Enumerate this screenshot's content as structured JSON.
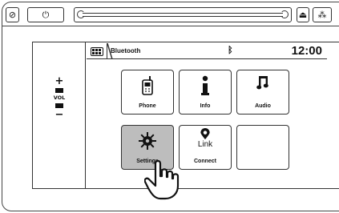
{
  "top_controls": {
    "left_buttons": [
      {
        "name": "power-button",
        "glyph": "⊘"
      },
      {
        "name": "knob-button",
        "glyph": "⏻"
      }
    ],
    "right_buttons": [
      {
        "name": "eject-button",
        "glyph": "⏏"
      },
      {
        "name": "seek-button",
        "glyph": "⁂"
      }
    ]
  },
  "volume": {
    "plus": "+",
    "label": "VOL",
    "minus": "−"
  },
  "status_bar": {
    "title": "Bluetooth",
    "bluetooth_symbol": "ᛒ",
    "time": "12:00"
  },
  "apps": [
    {
      "id": "phone",
      "label": "Phone",
      "icon": "phone-icon",
      "active": false
    },
    {
      "id": "info",
      "label": "Info",
      "icon": "info-icon",
      "active": false
    },
    {
      "id": "audio",
      "label": "Audio",
      "icon": "music-note-icon",
      "active": false
    },
    {
      "id": "settings",
      "label": "Settings",
      "icon": "gear-icon",
      "active": true
    },
    {
      "id": "connect",
      "label": "Connect",
      "icon": "link-icon",
      "active": false,
      "icon_text": "Link"
    },
    {
      "id": "empty",
      "label": "",
      "icon": "",
      "active": false
    }
  ],
  "colors": {
    "active_tile": "#bdbdbd",
    "line": "#333333"
  }
}
